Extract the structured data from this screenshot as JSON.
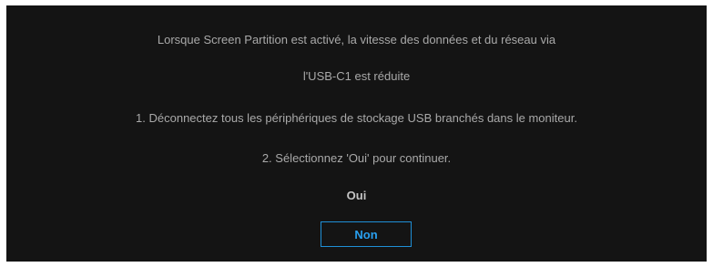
{
  "dialog": {
    "message_line_1": "Lorsque Screen Partition est activé, la vitesse des données et du réseau via",
    "message_line_2": "l'USB-C1 est réduite",
    "instruction_1": "1. Déconnectez tous les périphériques de stockage USB branchés dans le moniteur.",
    "instruction_2": "2. Sélectionnez 'Oui' pour continuer.",
    "options": {
      "yes_label": "Oui",
      "no_label": "Non",
      "selected": "Non"
    }
  },
  "colors": {
    "background": "#141414",
    "text": "#a9a9a9",
    "accent": "#1f8fd6"
  }
}
